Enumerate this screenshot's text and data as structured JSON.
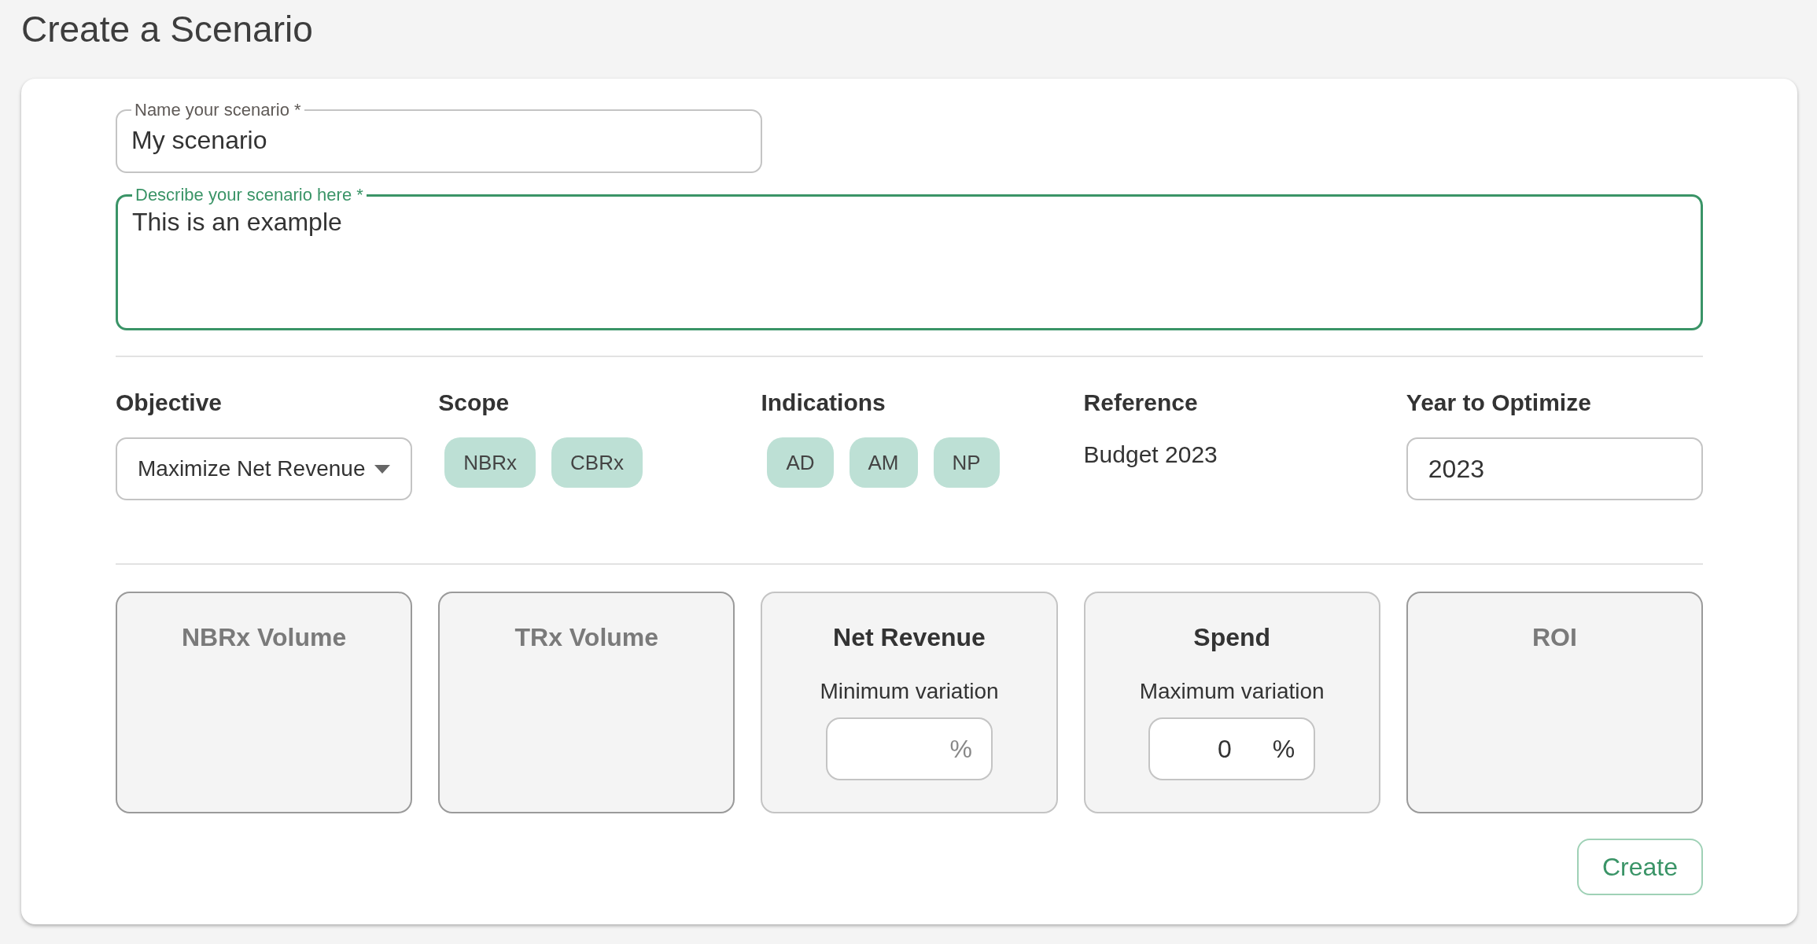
{
  "title": "Create a Scenario",
  "name_field": {
    "label": "Name your scenario *",
    "value": "My scenario",
    "focused": false
  },
  "description_field": {
    "label": "Describe your scenario here *",
    "value": "This is an example",
    "focused": true
  },
  "settings": [
    {
      "kind": "select",
      "heading": "Objective",
      "value": "Maximize Net Revenue"
    },
    {
      "kind": "chips",
      "heading": "Scope",
      "chips": [
        "NBRx",
        "CBRx"
      ]
    },
    {
      "kind": "chips",
      "heading": "Indications",
      "chips": [
        "AD",
        "AM",
        "NP"
      ]
    },
    {
      "kind": "text",
      "heading": "Reference",
      "value": "Budget 2023"
    },
    {
      "kind": "input",
      "heading": "Year to Optimize",
      "value": "2023"
    }
  ],
  "metrics": [
    {
      "title": "NBRx Volume",
      "enabled": false
    },
    {
      "title": "TRx Volume",
      "enabled": false
    },
    {
      "title": "Net Revenue",
      "enabled": true,
      "constraint_label": "Minimum variation",
      "unit": "%"
    },
    {
      "title": "Spend",
      "enabled": true,
      "constraint_label": "Maximum variation",
      "value": "0",
      "unit": "%"
    },
    {
      "title": "ROI",
      "enabled": false
    }
  ],
  "create_button": "Create"
}
